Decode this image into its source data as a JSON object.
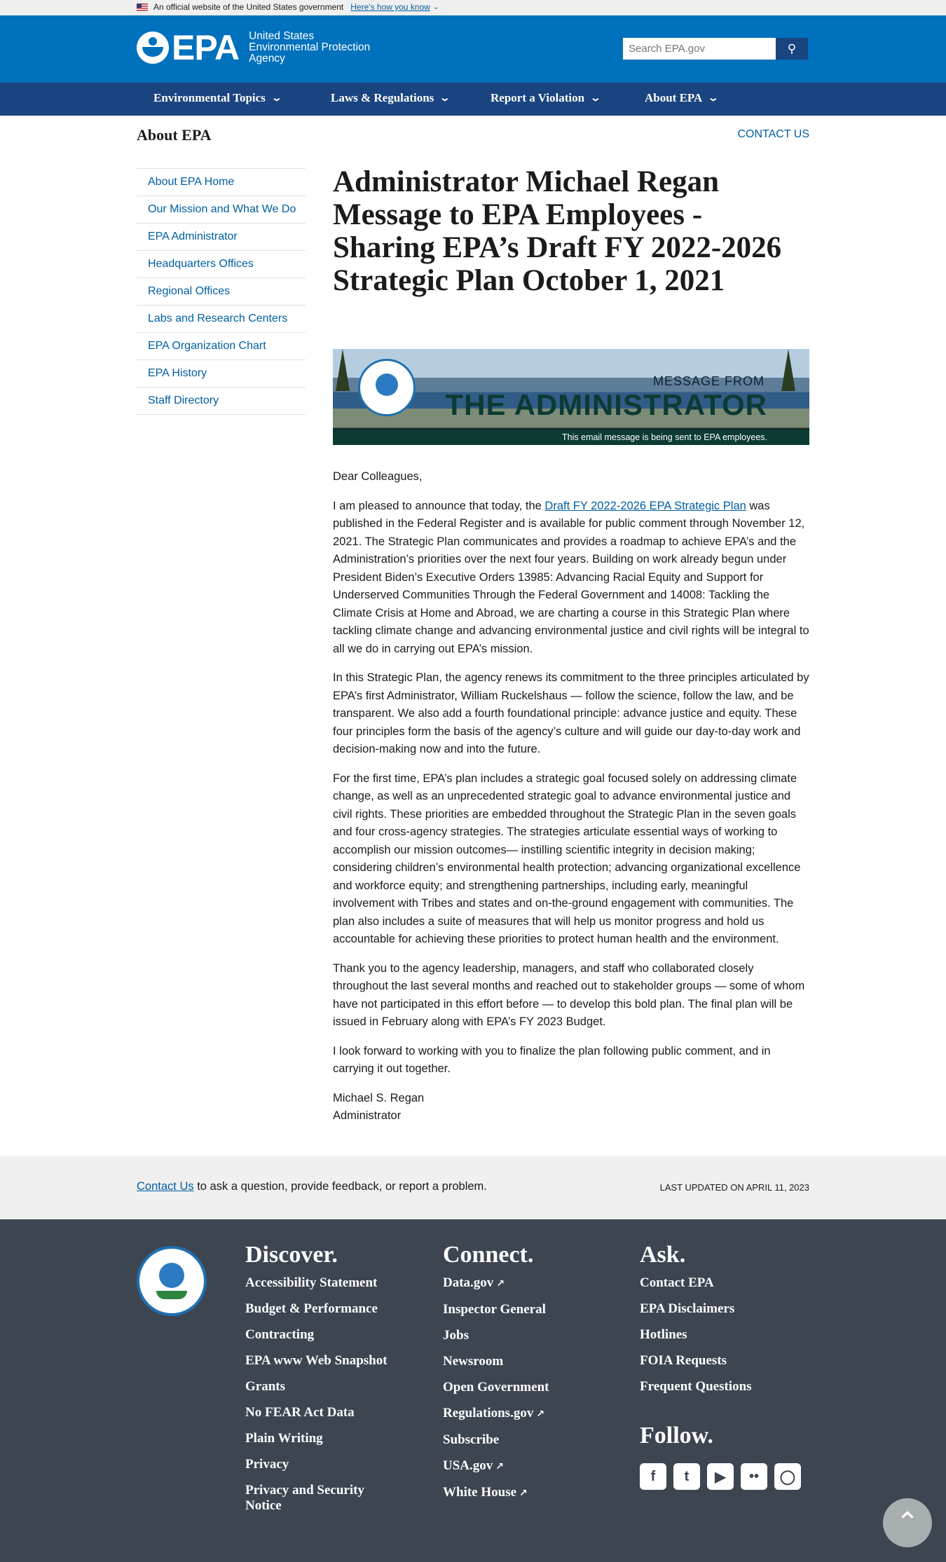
{
  "gov_banner": {
    "text": "An official website of the United States government",
    "how_link": "Here's how you know"
  },
  "header": {
    "logo_text": "EPA",
    "logo_sub_1": "United States",
    "logo_sub_2": "Environmental Protection",
    "logo_sub_3": "Agency",
    "search_placeholder": "Search EPA.gov",
    "search_icon": "magnifier-icon"
  },
  "nav": {
    "items": [
      {
        "label": "Environmental Topics"
      },
      {
        "label": "Laws & Regulations"
      },
      {
        "label": "Report a Violation"
      },
      {
        "label": "About EPA"
      }
    ]
  },
  "section": {
    "title": "About EPA",
    "contact": "CONTACT US"
  },
  "sidebar": {
    "items": [
      {
        "label": "About EPA Home"
      },
      {
        "label": "Our Mission and What We Do"
      },
      {
        "label": "EPA Administrator"
      },
      {
        "label": "Headquarters Offices"
      },
      {
        "label": "Regional Offices"
      },
      {
        "label": "Labs and Research Centers"
      },
      {
        "label": "EPA Organization Chart"
      },
      {
        "label": "EPA History"
      },
      {
        "label": "Staff Directory"
      }
    ]
  },
  "main": {
    "title": "Administrator Michael Regan Message to EPA Employees - Sharing EPA’s Draft FY 2022-2026 Strategic Plan October 1, 2021",
    "hero": {
      "message_from": "MESSAGE FROM",
      "administrator": "THE ADMINISTRATOR",
      "caption": "This email message is being sent to EPA employees."
    },
    "greeting": "Dear Colleagues,",
    "p1_before": "I am pleased to announce that today, the ",
    "p1_link": "Draft FY 2022-2026 EPA Strategic Plan",
    "p1_after": " was published in the Federal Register and is available for public comment through November 12, 2021. The Strategic Plan communicates and provides a roadmap to achieve EPA’s and the Administration’s priorities over the next four years. Building on work already begun under President Biden’s Executive Orders 13985: Advancing Racial Equity and Support for Underserved Communities Through the Federal Government and 14008: Tackling the Climate Crisis at Home and Abroad, we are charting a course in this Strategic Plan where tackling climate change and advancing environmental justice and civil rights will be integral to all we do in carrying out EPA’s mission.",
    "p2": "In this Strategic Plan, the agency renews its commitment to the three principles articulated by EPA’s first Administrator, William Ruckelshaus — follow the science, follow the law, and be transparent. We also add a fourth foundational principle: advance justice and equity. These four principles form the basis of the agency’s culture and will guide our day-to-day work and decision-making now and into the future.",
    "p3": "For the first time, EPA’s plan includes a strategic goal focused solely on addressing climate change, as well as an unprecedented strategic goal to advance environmental justice and civil rights. These priorities are embedded throughout the Strategic Plan in the seven goals and four cross-agency strategies. The strategies articulate essential ways of working to accomplish our mission outcomes— instilling scientific integrity in decision making; considering children’s environmental health protection; advancing organizational excellence and workforce equity; and strengthening partnerships, including early, meaningful involvement with Tribes and states and on-the-ground engagement with communities. The plan also includes a suite of measures that will help us monitor progress and hold us accountable for achieving these priorities to protect human health and the environment.",
    "p4": "Thank you to the agency leadership, managers, and staff who collaborated closely throughout the last several months and reached out to stakeholder groups — some of whom have not participated in this effort before — to develop this bold plan. The final plan will be issued in February along with EPA’s FY 2023 Budget.",
    "p5": "I look forward to working with you to finalize the plan following public comment, and in carrying it out together.",
    "signature_name": "Michael S. Regan",
    "signature_title": "Administrator"
  },
  "contact_strip": {
    "link": "Contact Us",
    "text": " to ask a question, provide feedback, or report a problem.",
    "updated": "LAST UPDATED ON APRIL 11, 2023"
  },
  "footer": {
    "discover": {
      "title": "Discover.",
      "links": [
        "Accessibility Statement",
        "Budget & Performance",
        "Contracting",
        "EPA www Web Snapshot",
        "Grants",
        "No FEAR Act Data",
        "Plain Writing",
        "Privacy",
        "Privacy and Security Notice"
      ]
    },
    "connect": {
      "title": "Connect.",
      "links": [
        "Data.gov",
        "Inspector General",
        "Jobs",
        "Newsroom",
        "Open Government",
        "Regulations.gov",
        "Subscribe",
        "USA.gov",
        "White House"
      ]
    },
    "ask": {
      "title": "Ask.",
      "links": [
        "Contact EPA",
        "EPA Disclaimers",
        "Hotlines",
        "FOIA Requests",
        "Frequent Questions"
      ]
    },
    "follow_title": "Follow.",
    "social_icons": [
      "facebook-icon",
      "twitter-icon",
      "youtube-icon",
      "flickr-icon",
      "instagram-icon"
    ],
    "colors": {
      "footer_bg": "#3d4551",
      "header_bg": "#0071bc",
      "nav_bg": "#1a4480",
      "link": "#005ea2"
    }
  }
}
